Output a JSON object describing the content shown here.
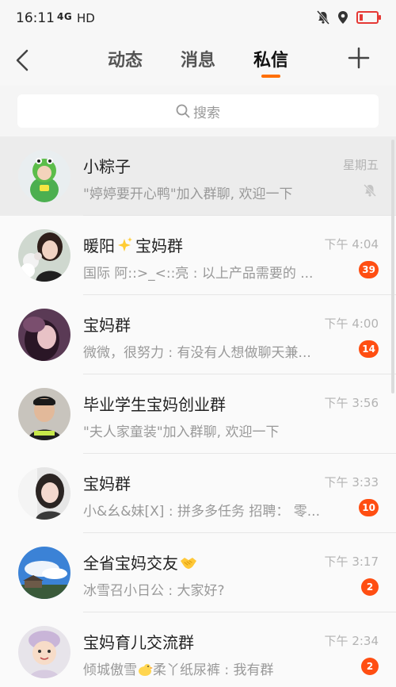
{
  "status_bar": {
    "time": "16:11",
    "network": "4G",
    "hd": "HD",
    "icons": [
      "mute-icon",
      "location-icon",
      "battery-low-icon"
    ],
    "battery_color": "#e53935"
  },
  "nav": {
    "tabs": [
      {
        "label": "动态"
      },
      {
        "label": "消息"
      },
      {
        "label": "私信"
      }
    ],
    "active_tab": "私信",
    "accent": "#ff6f00"
  },
  "search": {
    "placeholder": "搜索"
  },
  "chats": [
    {
      "name": "小粽子",
      "time": "星期五",
      "preview": "\"婷婷要开心鸭\"加入群聊, 欢迎一下",
      "badge": "",
      "muted": true
    },
    {
      "name_before": "暖阳",
      "name_after": "宝妈群",
      "time": "下午 4:04",
      "preview": "国际 阿::>_<::亮 : 以上产品需要的  ...",
      "badge": "39"
    },
    {
      "name": "宝妈群",
      "time": "下午 4:00",
      "preview": "微微，很努力 : 有没有人想做聊天兼...",
      "badge": "14"
    },
    {
      "name": "毕业学生宝妈创业群",
      "time": "下午 3:56",
      "preview": "\"夫人家童装\"加入群聊, 欢迎一下",
      "badge": ""
    },
    {
      "name": "宝妈群",
      "time": "下午 3:33",
      "preview": "小&幺&妹[X] : 拼多多任务 招聘：  零...",
      "badge": "10"
    },
    {
      "name": "全省宝妈交友",
      "time": "下午 3:17",
      "preview": "冰雪召小日公 : 大家好?",
      "badge": "2"
    },
    {
      "name": "宝妈育儿交流群",
      "time": "下午 2:34",
      "preview_before": "倾城傲雪",
      "preview_after": "柔丫纸尿裤 : 我有群",
      "badge": "2"
    }
  ],
  "badge_color": "#ff4e12"
}
